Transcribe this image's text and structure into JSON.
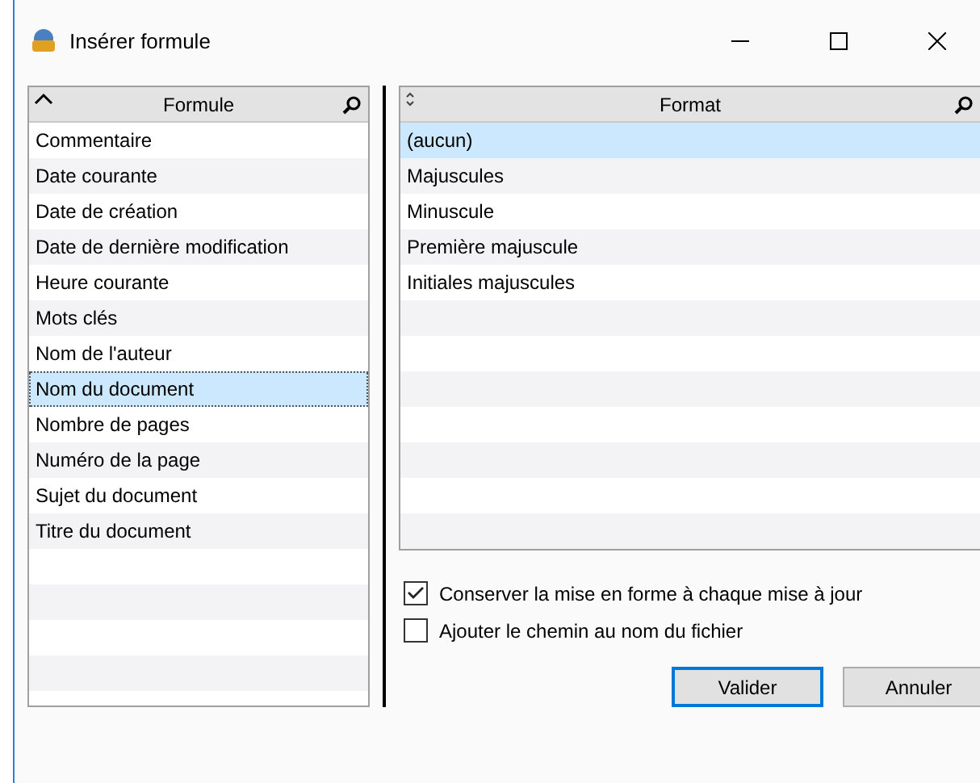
{
  "window": {
    "title": "Insérer formule"
  },
  "formula_list": {
    "header": "Formule",
    "sorted": true,
    "items": [
      {
        "label": "Commentaire",
        "selected": false
      },
      {
        "label": "Date courante",
        "selected": false
      },
      {
        "label": "Date de création",
        "selected": false
      },
      {
        "label": "Date de dernière modification",
        "selected": false
      },
      {
        "label": "Heure courante",
        "selected": false
      },
      {
        "label": "Mots clés",
        "selected": false
      },
      {
        "label": "Nom de l'auteur",
        "selected": false
      },
      {
        "label": "Nom du document",
        "selected": true
      },
      {
        "label": "Nombre de pages",
        "selected": false
      },
      {
        "label": "Numéro de la page",
        "selected": false
      },
      {
        "label": "Sujet du document",
        "selected": false
      },
      {
        "label": "Titre du document",
        "selected": false
      }
    ]
  },
  "format_list": {
    "header": "Format",
    "sorted": false,
    "items": [
      {
        "label": "(aucun)",
        "selected": true
      },
      {
        "label": "Majuscules",
        "selected": false
      },
      {
        "label": "Minuscule",
        "selected": false
      },
      {
        "label": "Première majuscule",
        "selected": false
      },
      {
        "label": "Initiales majuscules",
        "selected": false
      }
    ]
  },
  "options": [
    {
      "label": "Conserver la mise en forme à chaque mise à jour",
      "checked": true
    },
    {
      "label": "Ajouter le chemin au nom du fichier",
      "checked": false
    }
  ],
  "buttons": [
    {
      "label": "Valider",
      "default": true
    },
    {
      "label": "Annuler",
      "default": false
    }
  ]
}
